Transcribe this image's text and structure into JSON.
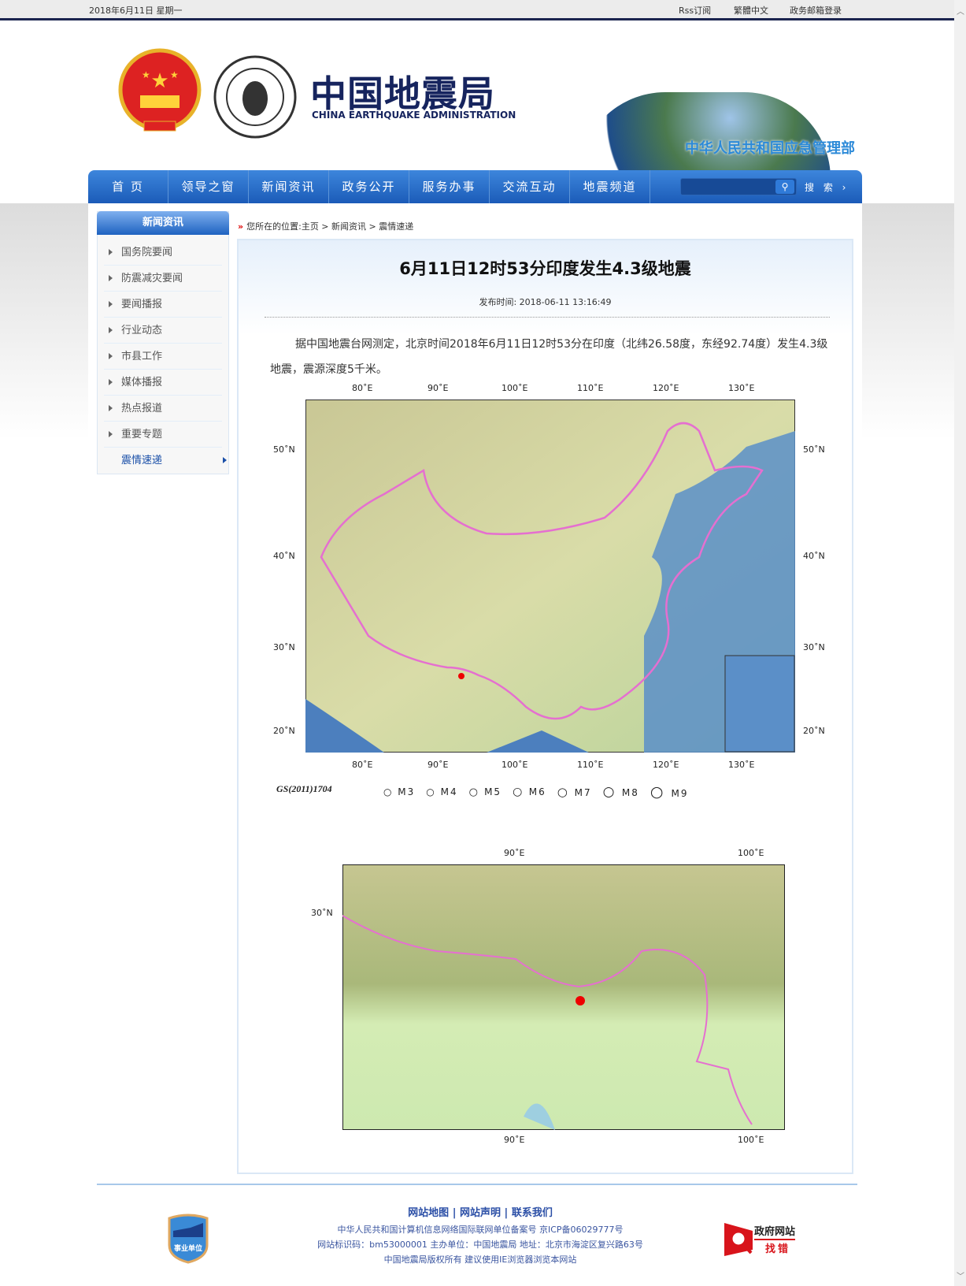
{
  "topbar": {
    "date": "2018年6月11日  星期一",
    "rss": "Rss订阅",
    "traditional": "繁體中文",
    "mail": "政务邮箱登录"
  },
  "header": {
    "title_cn": "中国地震局",
    "title_en": "CHINA EARTHQUAKE ADMINISTRATION",
    "ministry": "中华人民共和国应急管理部"
  },
  "nav": {
    "items": [
      "首 页",
      "领导之窗",
      "新闻资讯",
      "政务公开",
      "服务办事",
      "交流互动",
      "地震频道"
    ],
    "search_placeholder": "",
    "search_label": "搜 索 ›"
  },
  "sidebar": {
    "title": "新闻资讯",
    "items": [
      "国务院要闻",
      "防震减灾要闻",
      "要闻播报",
      "行业动态",
      "市县工作",
      "媒体播报",
      "热点报道",
      "重要专题",
      "震情速递"
    ]
  },
  "breadcrumb": "您所在的位置:主页 > 新闻资讯 > 震情速递",
  "article": {
    "title": "6月11日12时53分印度发生4.3级地震",
    "pubtime": "发布时间: 2018-06-11 13:16:49",
    "body": "据中国地震台网测定，北京时间2018年6月11日12时53分在印度（北纬26.58度，东经92.74度）发生4.3级地震，震源深度5千米。"
  },
  "map1": {
    "lon_ticks": [
      "80˚E",
      "90˚E",
      "100˚E",
      "110˚E",
      "120˚E",
      "130˚E"
    ],
    "lat_ticks": [
      "50˚N",
      "40˚N",
      "30˚N",
      "20˚N"
    ],
    "code": "GS(2011)1704",
    "legend": [
      "M3",
      "M4",
      "M5",
      "M6",
      "M7",
      "M8",
      "M9"
    ],
    "epicenter": {
      "lat": 26.58,
      "lon": 92.74
    }
  },
  "map2": {
    "lon_ticks": [
      "90˚E",
      "100˚E"
    ],
    "lat_ticks": [
      "30˚N"
    ]
  },
  "footer": {
    "links": [
      "网站地图",
      "网站声明",
      "联系我们"
    ],
    "line1": "中华人民共和国计算机信息网络国际联网单位备案号 京ICP备06029777号",
    "line2": "网站标识码：bm53000001  主办单位：中国地震局  地址：北京市海淀区复兴路63号",
    "line3": "中国地震局版权所有  建议使用IE浏览器浏览本网站",
    "badge": "事业单位",
    "gov_label1": "政府网站",
    "gov_label2": "找错"
  }
}
